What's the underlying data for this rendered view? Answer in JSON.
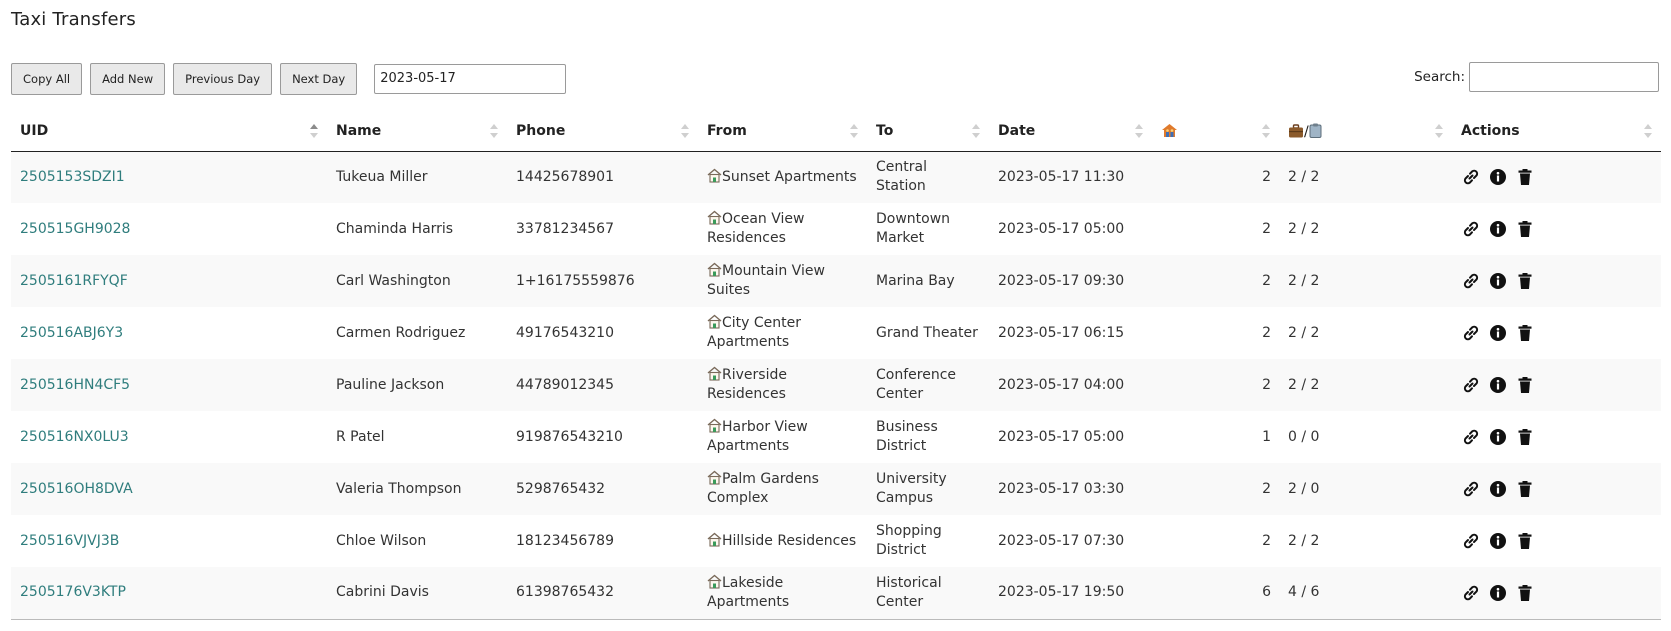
{
  "page": {
    "title": "Taxi Transfers"
  },
  "toolbar": {
    "copy_all": "Copy All",
    "add_new": "Add New",
    "previous_day": "Previous Day",
    "next_day": "Next Day",
    "date_value": "2023-05-17",
    "search_label": "Search:",
    "search_value": ""
  },
  "table": {
    "columns": [
      "UID",
      "Name",
      "Phone",
      "From",
      "To",
      "Date",
      "",
      "",
      "Actions"
    ],
    "pax_icon": "house-people-icon",
    "luggage_icon": "briefcase-clipboard-icon",
    "luggage_sep": "/",
    "sorted_column": "UID",
    "sort_direction": "ascending",
    "rows": [
      {
        "uid": "2505153SDZI1",
        "name": "Tukeua Miller",
        "phone": "14425678901",
        "from": "Sunset Apartments",
        "to": "Central Station",
        "date": "2023-05-17 11:30",
        "pax": "2",
        "luggage": "2 / 2"
      },
      {
        "uid": "250515GH9028",
        "name": "Chaminda Harris",
        "phone": "33781234567",
        "from": "Ocean View Residences",
        "to": "Downtown Market",
        "date": "2023-05-17 05:00",
        "pax": "2",
        "luggage": "2 / 2"
      },
      {
        "uid": "2505161RFYQF",
        "name": "Carl Washington",
        "phone": "1+16175559876",
        "from": "Mountain View Suites",
        "to": "Marina Bay",
        "date": "2023-05-17 09:30",
        "pax": "2",
        "luggage": "2 / 2"
      },
      {
        "uid": "250516ABJ6Y3",
        "name": "Carmen Rodriguez",
        "phone": "49176543210",
        "from": "City Center Apartments",
        "to": "Grand Theater",
        "date": "2023-05-17 06:15",
        "pax": "2",
        "luggage": "2 / 2"
      },
      {
        "uid": "250516HN4CF5",
        "name": "Pauline Jackson",
        "phone": "44789012345",
        "from": "Riverside Residences",
        "to": "Conference Center",
        "date": "2023-05-17 04:00",
        "pax": "2",
        "luggage": "2 / 2"
      },
      {
        "uid": "250516NX0LU3",
        "name": "R Patel",
        "phone": "919876543210",
        "from": "Harbor View Apartments",
        "to": "Business District",
        "date": "2023-05-17 05:00",
        "pax": "1",
        "luggage": "0 / 0"
      },
      {
        "uid": "250516OH8DVA",
        "name": "Valeria Thompson",
        "phone": "5298765432",
        "from": "Palm Gardens Complex",
        "to": "University Campus",
        "date": "2023-05-17 03:30",
        "pax": "2",
        "luggage": "2 / 0"
      },
      {
        "uid": "250516VJVJ3B",
        "name": "Chloe Wilson",
        "phone": "18123456789",
        "from": "Hillside Residences",
        "to": "Shopping District",
        "date": "2023-05-17 07:30",
        "pax": "2",
        "luggage": "2 / 2"
      },
      {
        "uid": "2505176V3KTP",
        "name": "Cabrini Davis",
        "phone": "61398765432",
        "from": "Lakeside Apartments",
        "to": "Historical Center",
        "date": "2023-05-17 19:50",
        "pax": "6",
        "luggage": "4 / 6"
      }
    ]
  },
  "icons": {
    "from_prefix": "house-icon",
    "actions": [
      "link-icon",
      "info-icon",
      "trash-icon"
    ]
  },
  "colors": {
    "uid_link": "#2f7d7d",
    "zebra": "#f9f9f9"
  }
}
